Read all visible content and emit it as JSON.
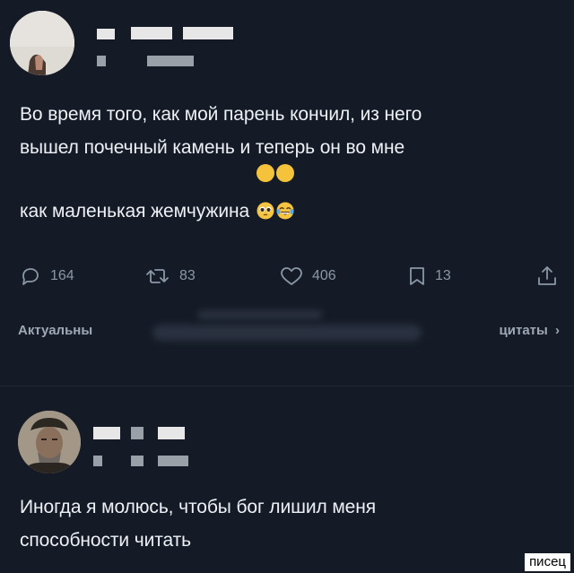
{
  "post1": {
    "text": "Во время того, как мой парень кончил, из него\nвышел почечный камень и теперь он во мне\nкак маленькая жемчужина",
    "emojis": [
      "pleading-face-icon",
      "tears-of-joy-icon"
    ],
    "stats": {
      "replies": "164",
      "reposts": "83",
      "likes": "406",
      "bookmarks": "13"
    },
    "actual_label": "Актуальны",
    "quotes_label": "цитаты",
    "chevron": "›"
  },
  "post2": {
    "text": "Иногда я молюсь, чтобы бог лишил меня\nспособности читать"
  },
  "watermark": "писец",
  "colors": {
    "background": "#141b26",
    "text": "#edf0f4",
    "muted": "#8b97a6"
  }
}
